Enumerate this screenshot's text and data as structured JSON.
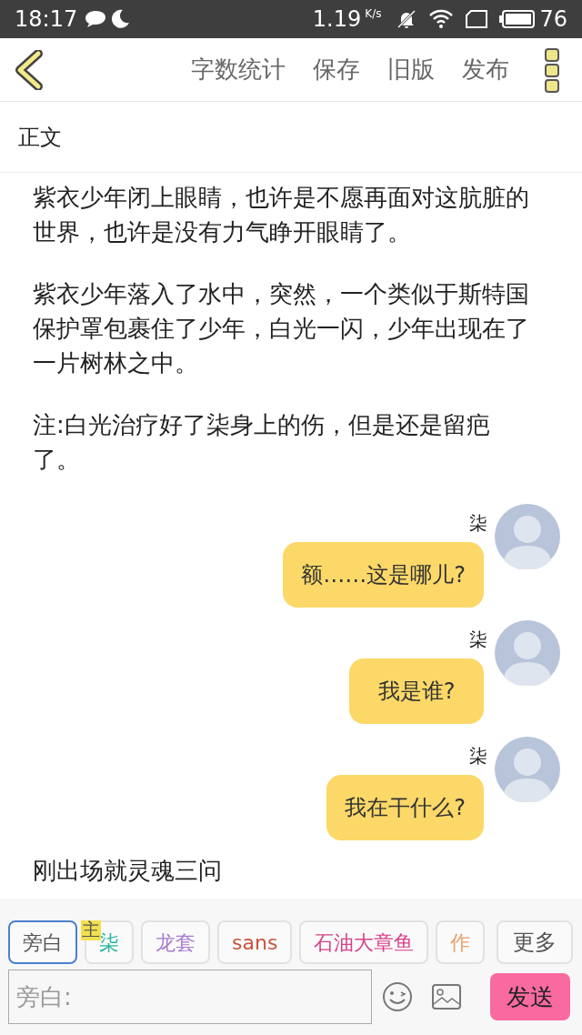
{
  "status_bar": {
    "time": "18:17",
    "speed": "1.19",
    "speed_unit": "K/s",
    "battery": "76"
  },
  "toolbar": {
    "actions": [
      "字数统计",
      "保存",
      "旧版",
      "发布"
    ]
  },
  "section_title": "正文",
  "content": [
    {
      "kind": "paragraph",
      "text": "紫衣少年闭上眼睛，也许是不愿再面对这肮脏的世界，也许是没有力气睁开眼睛了。"
    },
    {
      "kind": "paragraph",
      "text": "紫衣少年落入了水中，突然，一个类似于斯特国保护罩包裹住了少年，白光一闪，少年出现在了一片树林之中。"
    },
    {
      "kind": "paragraph",
      "text": "注:白光治疗好了柒身上的伤，但是还是留疤了。"
    },
    {
      "kind": "message",
      "name": "柒",
      "text": "额……这是哪儿?"
    },
    {
      "kind": "message",
      "name": "柒",
      "text": "我是谁?"
    },
    {
      "kind": "message",
      "name": "柒",
      "text": "我在干什么?"
    },
    {
      "kind": "paragraph",
      "text": "刚出场就灵魂三问"
    }
  ],
  "roles": [
    {
      "label": "旁白",
      "selected": true,
      "color": "#555555"
    },
    {
      "label": "柒",
      "selected": false,
      "color": "#2bb5a0",
      "badge": "主"
    },
    {
      "label": "龙套",
      "selected": false,
      "color": "#a77bd0"
    },
    {
      "label": "sans",
      "selected": false,
      "color": "#c8553d"
    },
    {
      "label": "石油大章鱼",
      "selected": false,
      "color": "#d6418a"
    },
    {
      "label": "作",
      "selected": false,
      "color": "#e8a06a"
    }
  ],
  "more_button": "更多",
  "input": {
    "placeholder": "旁白:"
  },
  "send_button": "发送"
}
